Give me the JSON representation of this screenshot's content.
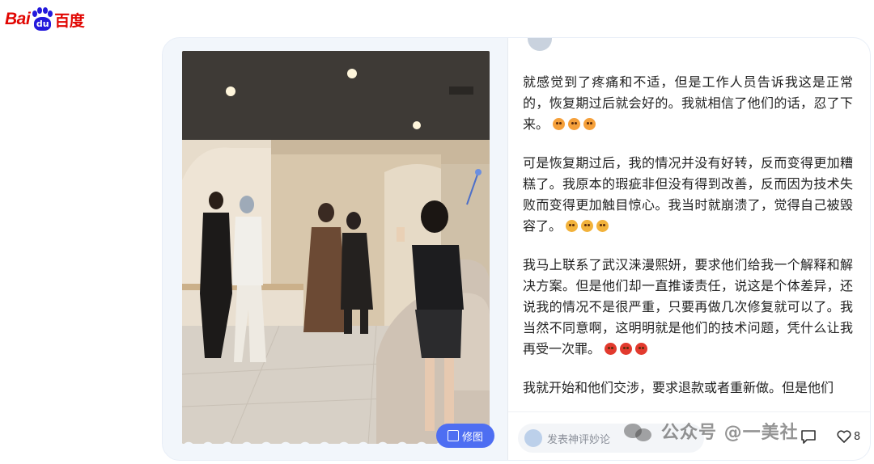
{
  "brand": {
    "logo_left": "Bai",
    "logo_paw": "du",
    "logo_right": "百度"
  },
  "article": {
    "paragraphs": [
      {
        "text": "就感觉到了疼痛和不适，但是工作人员告诉我这是正常的，恢复期过后就会好的。我就相信了他们的话，忍了下来。",
        "emoji": "angry"
      },
      {
        "text": "可是恢复期过后，我的情况并没有好转，反而变得更加糟糕了。我原本的瑕疵非但没有得到改善，反而因为技术失败而变得更加触目惊心。我当时就崩溃了，觉得自己被毁容了。",
        "emoji": "cry"
      },
      {
        "text": "我马上联系了武汉涞漫熙妍，要求他们给我一个解释和解决方案。但是他们却一直推诿责任，说这是个体差异，还说我的情况不是很严重，只要再做几次修复就可以了。我当然不同意啊，这明明就是他们的技术问题，凭什么让我再受一次罪。",
        "emoji": "red"
      },
      {
        "text": "我就开始和他们交涉，要求退款或者重新做。但是他们",
        "emoji": ""
      }
    ]
  },
  "image_tool": {
    "label": "修图"
  },
  "comment": {
    "placeholder": "发表神评妙论"
  },
  "actions": {
    "like_count": "8"
  },
  "watermark": {
    "text": "公众号 @一美社"
  },
  "colors": {
    "accent": "#4e6ef2",
    "baidu_red": "#e10602",
    "baidu_blue": "#2319dc"
  }
}
